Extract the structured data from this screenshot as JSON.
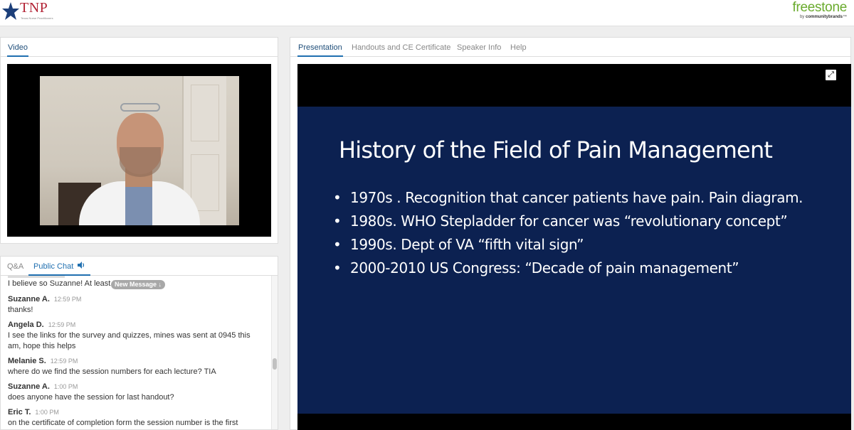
{
  "header": {
    "tnp_logo_text": "TNP",
    "tnp_logo_subtext": "Texas Nurse Practitioners",
    "freestone_logo_text": "freestone",
    "freestone_by": "by",
    "freestone_brand": "communitybrands",
    "freestone_tm": "™"
  },
  "video_panel": {
    "tabs": [
      {
        "label": "Video",
        "active": true
      }
    ]
  },
  "chat_panel": {
    "tabs": [
      {
        "label": "Q&A",
        "active": false
      },
      {
        "label": "Public Chat",
        "active": true,
        "icon": "speaker-icon"
      }
    ],
    "new_message_label": "New Message ↓",
    "messages": [
      {
        "name": "",
        "time": "",
        "text": "I believe so Suzanne! At least I"
      },
      {
        "name": "Suzanne A.",
        "time": "12:59 PM",
        "text": "thanks!"
      },
      {
        "name": "Angela D.",
        "time": "12:59 PM",
        "text": "I see the links for the survey and quizzes, mines was sent at 0945 this am, hope this helps"
      },
      {
        "name": "Melanie S.",
        "time": "12:59 PM",
        "text": "where do we find the session numbers for each lecture? TIA"
      },
      {
        "name": "Suzanne A.",
        "time": "1:00 PM",
        "text": "does anyone have the session for last handout?"
      },
      {
        "name": "Eric T.",
        "time": "1:00 PM",
        "text": "on the certificate of completion form the session number is the first"
      }
    ]
  },
  "presentation_panel": {
    "tabs": [
      {
        "label": "Presentation",
        "active": true
      },
      {
        "label": "Handouts and CE Certificate",
        "active": false
      },
      {
        "label": "Speaker Info",
        "active": false
      },
      {
        "label": "Help",
        "active": false
      }
    ],
    "expand_icon": "⤢",
    "slide": {
      "title": "History of the Field of Pain Management",
      "bullets": [
        "1970s .  Recognition that cancer patients have pain.  Pain diagram.",
        "1980s.  WHO Stepladder for cancer was “revolutionary concept”",
        "1990s.  Dept of VA “fifth vital sign”",
        "2000-2010 US Congress:  “Decade of pain management”"
      ]
    }
  },
  "colors": {
    "slide_background": "#0c2151",
    "active_tab": "#1f4e79",
    "tnp_red": "#b22234",
    "tnp_blue": "#1c3f7a",
    "freestone_green": "#6aab2e"
  }
}
